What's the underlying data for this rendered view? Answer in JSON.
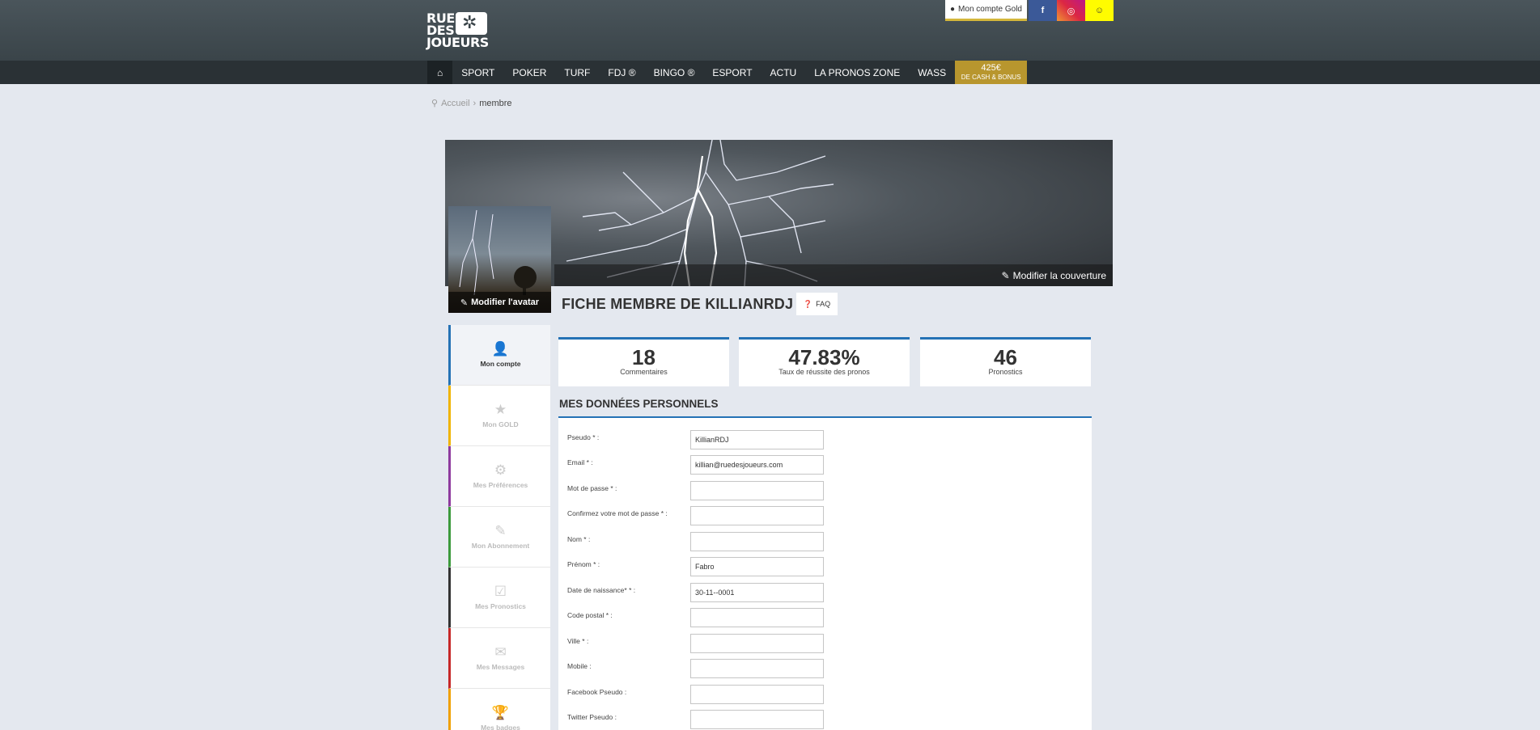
{
  "brand": {
    "logo_line1": "RUE",
    "logo_line2": "DES",
    "logo_line3": "JOUEURS",
    "badge_glyph": "✲"
  },
  "top": {
    "gold_label": "Mon compte Gold",
    "fb": "f",
    "ig": "◎",
    "sc": "☺"
  },
  "nav": {
    "home_icon": "⌂",
    "items": [
      "SPORT",
      "POKER",
      "TURF",
      "FDJ ®",
      "BINGO ®",
      "ESPORT",
      "ACTU",
      "LA PRONOS ZONE",
      "WASS"
    ],
    "promo_amount": "425€",
    "promo_sub": "DE CASH & BONUS"
  },
  "breadcrumb": {
    "home": "Accueil",
    "sep": "›",
    "current": "membre"
  },
  "cover": {
    "edit_label": "Modifier la couverture"
  },
  "avatar": {
    "edit_label": "Modifier l'avatar"
  },
  "profile": {
    "title": "FICHE MEMBRE DE KILLIANRDJ",
    "faq": "FAQ"
  },
  "sidebar": {
    "items": [
      {
        "label": "Mon compte",
        "icon": "👤"
      },
      {
        "label": "Mon GOLD",
        "icon": "★"
      },
      {
        "label": "Mes Préférences",
        "icon": "⚙"
      },
      {
        "label": "Mon Abonnement",
        "icon": "✎"
      },
      {
        "label": "Mes Pronostics",
        "icon": "☑"
      },
      {
        "label": "Mes Messages",
        "icon": "✉"
      },
      {
        "label": "Mes badges",
        "icon": "🏆"
      }
    ],
    "colors": [
      "#2472b5",
      "#f0b400",
      "#8e3a9e",
      "#3c9a3c",
      "#333333",
      "#c62828",
      "#f0a000"
    ]
  },
  "stats": [
    {
      "value": "18",
      "label": "Commentaires"
    },
    {
      "value": "47.83%",
      "label": "Taux de réussite des pronos"
    },
    {
      "value": "46",
      "label": "Pronostics"
    }
  ],
  "section_title": "MES DONNÉES PERSONNELS",
  "form": [
    {
      "label": "Pseudo * :",
      "value": "KillianRDJ"
    },
    {
      "label": "Email * :",
      "value": "killian@ruedesjoueurs.com"
    },
    {
      "label": "Mot de passe * :",
      "value": ""
    },
    {
      "label": "Confirmez votre mot de passe * :",
      "value": ""
    },
    {
      "label": "Nom * :",
      "value": ""
    },
    {
      "label": "Prénom * :",
      "value": "Fabro"
    },
    {
      "label": "Date de naissance* * :",
      "value": "30-11--0001"
    },
    {
      "label": "Code postal * :",
      "value": ""
    },
    {
      "label": "Ville * :",
      "value": ""
    },
    {
      "label": "Mobile :",
      "value": ""
    },
    {
      "label": "Facebook Pseudo :",
      "value": ""
    },
    {
      "label": "Twitter Pseudo :",
      "value": ""
    }
  ]
}
